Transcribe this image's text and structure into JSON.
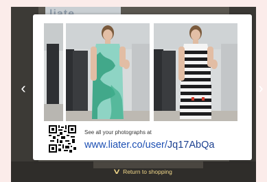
{
  "background": {
    "sign_text": "liate"
  },
  "gallery": {
    "prev_arrow": "‹",
    "next_arrow": "›"
  },
  "card": {
    "caption": "See all your photographs at",
    "url_prefix": "www.liater.co/user/",
    "url_code": "Jq17AbQa"
  },
  "footer": {
    "return_label": "Return to shopping",
    "return_icon": "chevron-down-icon"
  },
  "colors": {
    "url": "#1c4fb3",
    "return_text": "#f3d98a",
    "card": "#ffffff",
    "backdrop": "#5a5750"
  }
}
